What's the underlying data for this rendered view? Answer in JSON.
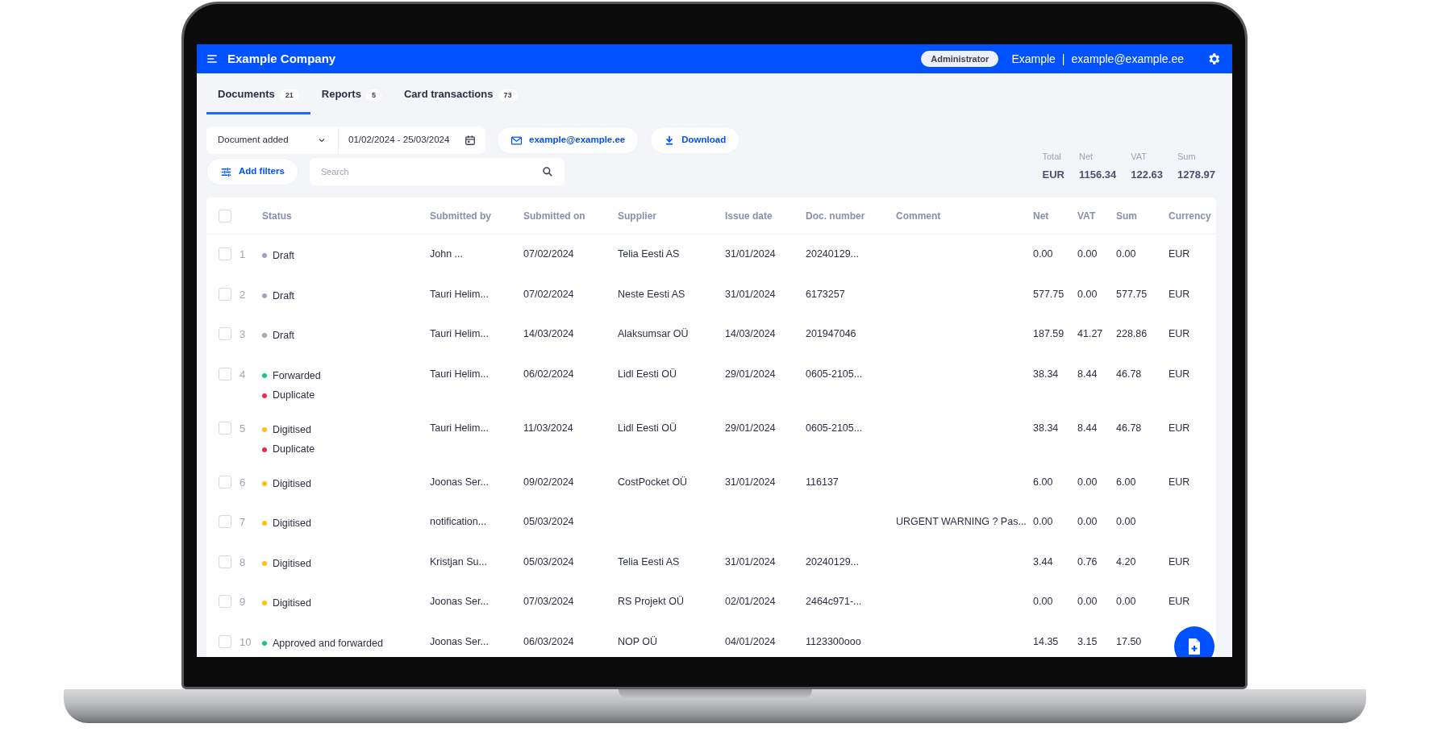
{
  "header": {
    "company": "Example Company",
    "role": "Administrator",
    "user": "Example",
    "separator": "|",
    "email": "example@example.ee"
  },
  "tabs": [
    {
      "label": "Documents",
      "count": "21",
      "selected": true
    },
    {
      "label": "Reports",
      "count": "5",
      "selected": false
    },
    {
      "label": "Card transactions",
      "count": "73",
      "selected": false
    }
  ],
  "filters": {
    "date_type": "Document added",
    "date_range": "01/02/2024 - 25/03/2024",
    "email_button": "example@example.ee",
    "download_button": "Download",
    "add_filters_button": "Add filters",
    "search": {
      "placeholder": "Search"
    }
  },
  "totals": [
    {
      "label": "Total",
      "value": "EUR"
    },
    {
      "label": "Net",
      "value": "1156.34"
    },
    {
      "label": "VAT",
      "value": "122.63"
    },
    {
      "label": "Sum",
      "value": "1278.97"
    }
  ],
  "table": {
    "select_all_checked": false,
    "columns": [
      "Status",
      "Submitted by",
      "Submitted on",
      "Supplier",
      "Issue date",
      "Doc. number",
      "Comment",
      "Net",
      "VAT",
      "Sum",
      "Currency"
    ],
    "rows": [
      {
        "number": "1",
        "checked": false,
        "statuses": [
          {
            "label": "Draft",
            "color": "#a0a4b8"
          }
        ],
        "submitted_by": "John ...",
        "submitted_on": "07/02/2024",
        "supplier": "Telia Eesti AS",
        "issue_date": "31/01/2024",
        "doc_number": "20240129...",
        "net": "0.00",
        "vat": "0.00",
        "sum": "0.00",
        "currency": "EUR"
      },
      {
        "number": "2",
        "checked": false,
        "statuses": [
          {
            "label": "Draft",
            "color": "#a0a4b8"
          }
        ],
        "submitted_by": "Tauri Helim...",
        "submitted_on": "07/02/2024",
        "supplier": "Neste Eesti AS",
        "issue_date": "31/01/2024",
        "doc_number": "6173257",
        "net": "577.75",
        "vat": "0.00",
        "sum": "577.75",
        "currency": "EUR"
      },
      {
        "number": "3",
        "checked": false,
        "statuses": [
          {
            "label": "Draft",
            "color": "#a0a4b8"
          }
        ],
        "submitted_by": "Tauri Helim...",
        "submitted_on": "14/03/2024",
        "supplier": "Alaksumsar OÜ",
        "issue_date": "14/03/2024",
        "doc_number": "201947046",
        "net": "187.59",
        "vat": "41.27",
        "sum": "228.86",
        "currency": "EUR"
      },
      {
        "number": "4",
        "checked": false,
        "statuses": [
          {
            "label": "Forwarded",
            "color": "#1ec77f"
          },
          {
            "label": "Duplicate",
            "color": "#f0284a"
          }
        ],
        "submitted_by": "Tauri Helim...",
        "submitted_on": "06/02/2024",
        "supplier": "Lidl Eesti OÜ",
        "issue_date": "29/01/2024",
        "doc_number": "0605-2105...",
        "net": "38.34",
        "vat": "8.44",
        "sum": "46.78",
        "currency": "EUR"
      },
      {
        "number": "5",
        "checked": false,
        "statuses": [
          {
            "label": "Digitised",
            "color": "#ffc107"
          },
          {
            "label": "Duplicate",
            "color": "#f0284a"
          }
        ],
        "submitted_by": "Tauri Helim...",
        "submitted_on": "11/03/2024",
        "supplier": "Lidl Eesti OÜ",
        "issue_date": "29/01/2024",
        "doc_number": "0605-2105...",
        "net": "38.34",
        "vat": "8.44",
        "sum": "46.78",
        "currency": "EUR"
      },
      {
        "number": "6",
        "checked": false,
        "statuses": [
          {
            "label": "Digitised",
            "color": "#ffc107"
          }
        ],
        "submitted_by": "Joonas Ser...",
        "submitted_on": "09/02/2024",
        "supplier": "CostPocket OÜ",
        "issue_date": "31/01/2024",
        "doc_number": "116137",
        "net": "6.00",
        "vat": "0.00",
        "sum": "6.00",
        "currency": "EUR"
      },
      {
        "number": "7",
        "checked": false,
        "statuses": [
          {
            "label": "Digitised",
            "color": "#ffc107"
          }
        ],
        "submitted_by": "notification...",
        "submitted_on": "05/03/2024",
        "comment": "URGENT WARNING ? Pas...",
        "net": "0.00",
        "vat": "0.00",
        "sum": "0.00"
      },
      {
        "number": "8",
        "checked": false,
        "statuses": [
          {
            "label": "Digitised",
            "color": "#ffc107"
          }
        ],
        "submitted_by": "Kristjan Su...",
        "submitted_on": "05/03/2024",
        "supplier": "Telia Eesti AS",
        "issue_date": "31/01/2024",
        "doc_number": "20240129...",
        "net": "3.44",
        "vat": "0.76",
        "sum": "4.20",
        "currency": "EUR"
      },
      {
        "number": "9",
        "checked": false,
        "statuses": [
          {
            "label": "Digitised",
            "color": "#ffc107"
          }
        ],
        "submitted_by": "Joonas Ser...",
        "submitted_on": "07/03/2024",
        "supplier": "RS Projekt OÜ",
        "issue_date": "02/01/2024",
        "doc_number": "2464c971-...",
        "net": "0.00",
        "vat": "0.00",
        "sum": "0.00",
        "currency": "EUR"
      },
      {
        "number": "10",
        "checked": false,
        "statuses": [
          {
            "label": "Approved and forwarded",
            "color": "#1ec77f"
          }
        ],
        "submitted_by": "Joonas Ser...",
        "submitted_on": "06/03/2024",
        "supplier": "NOP OÜ",
        "issue_date": "04/01/2024",
        "doc_number": "1123300ooo",
        "net": "14.35",
        "vat": "3.15",
        "sum": "17.50"
      }
    ]
  }
}
